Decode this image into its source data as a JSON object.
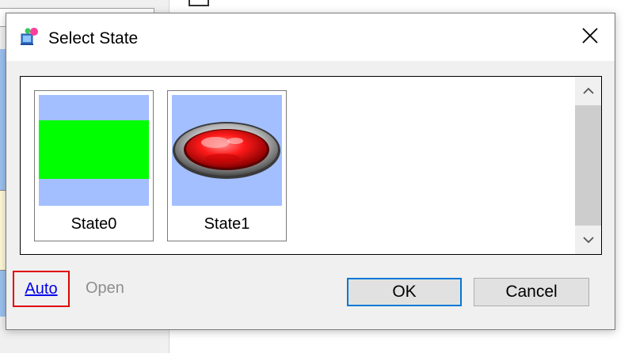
{
  "dialog": {
    "title": "Select State",
    "icon": "state-app-icon",
    "close_icon": "close-icon"
  },
  "states": [
    {
      "label": "State0",
      "thumb": "green-rectangle"
    },
    {
      "label": "State1",
      "thumb": "red-lamp"
    }
  ],
  "scrollbar": {
    "up_glyph": "⌃",
    "down_glyph": "⌄"
  },
  "footer": {
    "auto_label": "Auto",
    "open_label": "Open",
    "ok_label": "OK",
    "cancel_label": "Cancel"
  },
  "colors": {
    "thumb_background": "#a3bfff",
    "state0_fill": "#00ff00",
    "lamp_red": "#e00000",
    "focus_border": "#0078d7",
    "highlight_box": "#e00000"
  }
}
